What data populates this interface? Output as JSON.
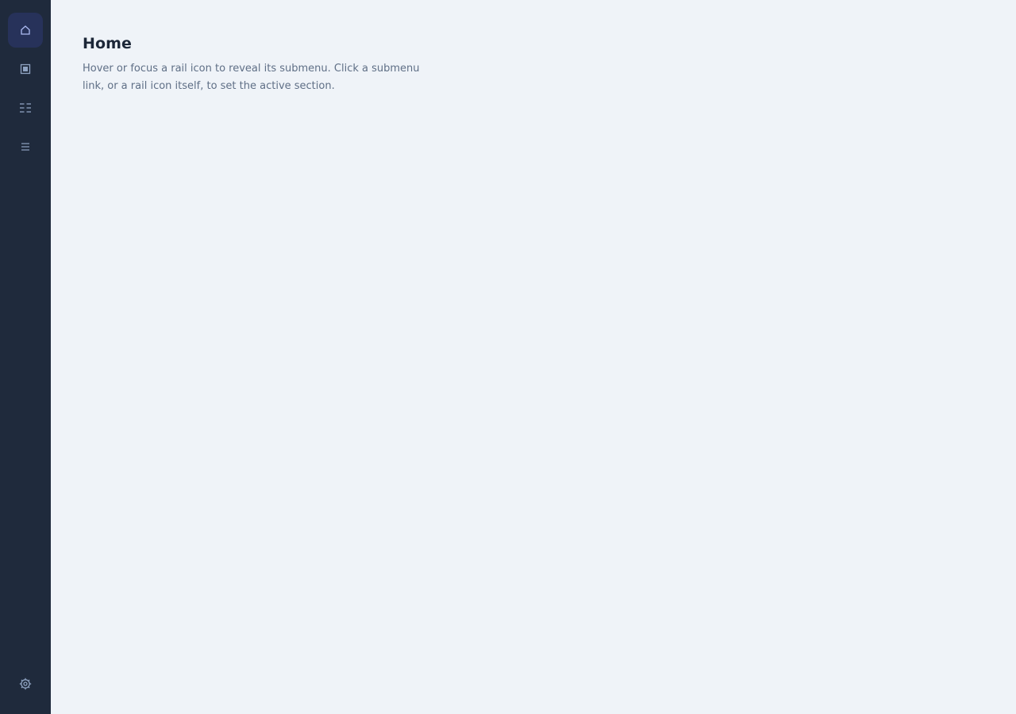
{
  "rail": {
    "items": [
      {
        "id": "home",
        "icon": "home-icon",
        "active": true
      },
      {
        "id": "projects",
        "icon": "square-icon",
        "active": false
      },
      {
        "id": "reports",
        "icon": "columns-icon",
        "active": false
      },
      {
        "id": "list",
        "icon": "list-icon",
        "active": false
      }
    ],
    "settings": {
      "icon": "gear-icon"
    }
  },
  "main": {
    "title": "Home",
    "description": "Hover or focus a rail icon to reveal its submenu. Click a submenu link, or a rail icon itself, to set the active section."
  },
  "colors": {
    "rail_background": "#1f2a3c",
    "page_background": "#eff3f8",
    "active_item_background": "#27325a",
    "active_icon": "#aebcf4",
    "icon": "#8fa3c2",
    "title": "#1c2738",
    "description": "#5f6f86"
  }
}
